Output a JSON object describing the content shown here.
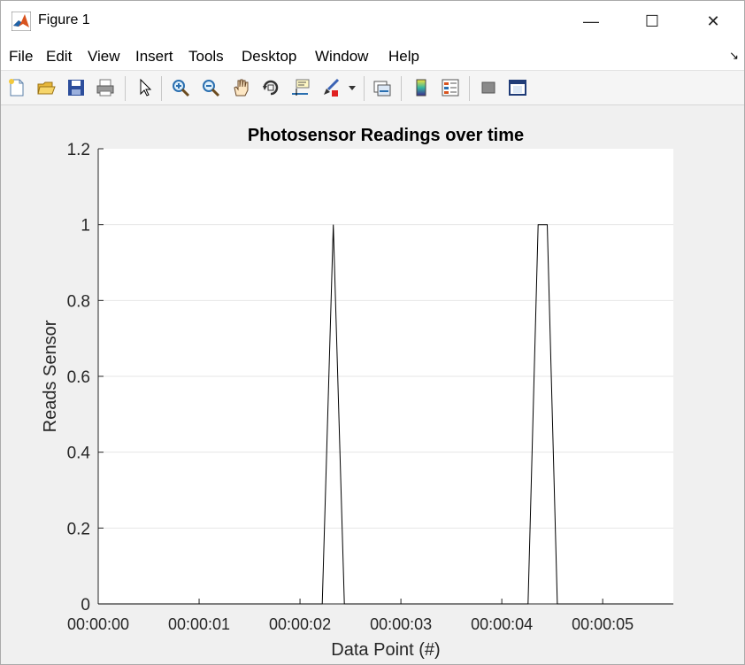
{
  "window": {
    "title": "Figure 1",
    "controls": {
      "minimize": "—",
      "maximize": "☐",
      "close": "✕"
    }
  },
  "menu": {
    "items": [
      "File",
      "Edit",
      "View",
      "Insert",
      "Tools",
      "Desktop",
      "Window",
      "Help"
    ],
    "dock_arrow": "↘"
  },
  "toolbar": {
    "icons": [
      "new-figure-icon",
      "open-file-icon",
      "save-icon",
      "print-icon",
      "edit-plot-arrow-icon",
      "zoom-in-icon",
      "zoom-out-icon",
      "pan-hand-icon",
      "rotate-3d-icon",
      "data-cursor-icon",
      "brush-icon",
      "link-plot-icon",
      "insert-colorbar-icon",
      "insert-legend-icon",
      "hide-plot-tools-icon",
      "show-plot-tools-icon"
    ]
  },
  "chart_data": {
    "type": "line",
    "title": "Photosensor Readings over time",
    "xlabel": "Data Point (#)",
    "ylabel": "Reads Sensor",
    "x_tick_labels": [
      "00:00:00",
      "00:00:01",
      "00:00:02",
      "00:00:03",
      "00:00:04",
      "00:00:05"
    ],
    "y_tick_labels": [
      "0",
      "0.2",
      "0.4",
      "0.6",
      "0.8",
      "1",
      "1.2"
    ],
    "xlim_seconds": [
      0,
      5.7
    ],
    "ylim": [
      0,
      1.2
    ],
    "grid": "horizontal",
    "series": [
      {
        "color": "#000000",
        "x_seconds": [
          0,
          2.22,
          2.33,
          2.44,
          4.26,
          4.36,
          4.45,
          4.55,
          5.7
        ],
        "y": [
          0,
          0,
          1,
          0,
          0,
          1,
          1,
          0,
          0
        ]
      }
    ]
  }
}
